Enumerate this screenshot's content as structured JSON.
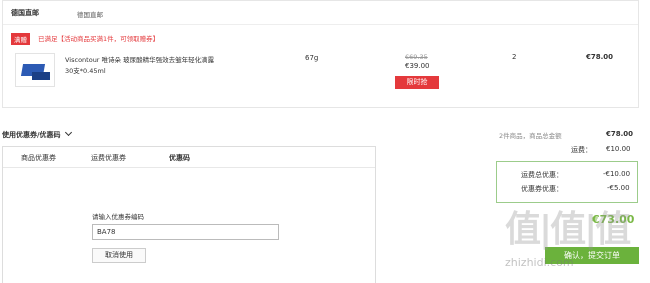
{
  "header": {
    "title": "德国直邮",
    "subtitle": "德国直邮"
  },
  "promo": {
    "tag": "满赠",
    "text": "已满足【活动商品买满1件，可领取赠券】"
  },
  "product": {
    "name_line1": "Viscontour 唯诗朵 玻尿酸精华强效去皱年轻化滴露",
    "name_line2": "30支*0.45ml",
    "weight": "67g",
    "old_price": "€69.35",
    "price": "€39.00",
    "flash_label": "限时抢",
    "qty": "2",
    "subtotal": "€78.00"
  },
  "coupon": {
    "toggle": "使用优惠券/优惠码",
    "tabs": [
      "商品优惠券",
      "运费优惠券",
      "优惠码"
    ],
    "input_label": "请输入优惠券编码",
    "input_value": "BA78",
    "cancel": "取消使用"
  },
  "summary": {
    "goods_label": "2件商品，商品总金额",
    "goods_value": "€78.00",
    "freight_label": "运费：",
    "freight_value": "€10.00",
    "freight_discount_label": "运费总优惠：",
    "freight_discount_value": "-€10.00",
    "coupon_discount_label": "优惠券优惠：",
    "coupon_discount_value": "-€5.00",
    "pay_total": "€73.00",
    "submit": "确认，提交订单"
  },
  "watermark": {
    "text": "值|值|值",
    "url": "zhizhidi.com"
  }
}
